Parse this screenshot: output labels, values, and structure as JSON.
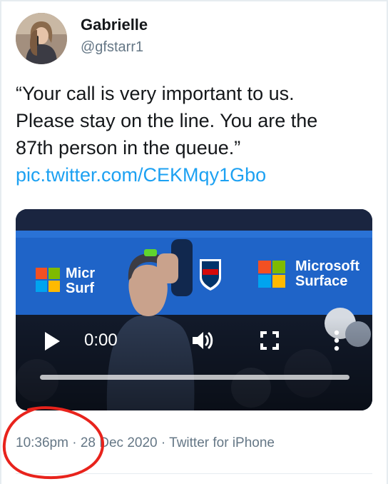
{
  "author": {
    "display_name": "Gabrielle",
    "handle": "@gfstarr1"
  },
  "tweet": {
    "text_lines": [
      "“Your call is very important to us.",
      "Please stay on the line. You are the",
      "87th person in the queue.”"
    ],
    "link": "pic.twitter.com/CEKMqy1Gbo"
  },
  "video": {
    "time": "0:00",
    "progress": 0,
    "brand_left": [
      "Micr",
      "Surf"
    ],
    "brand_right": [
      "Microsoft",
      "Surface"
    ],
    "play_icon": "play-icon",
    "volume_icon": "volume-icon",
    "fullscreen_icon": "fullscreen-icon",
    "more_icon": "more-vertical-icon"
  },
  "meta": {
    "time": "10:36pm",
    "separator": "·",
    "date": "28 Dec 2020",
    "source": "Twitter for iPhone"
  },
  "colors": {
    "link": "#1da1f2",
    "secondary_text": "#657786",
    "annotation_circle": "#e8231c"
  }
}
